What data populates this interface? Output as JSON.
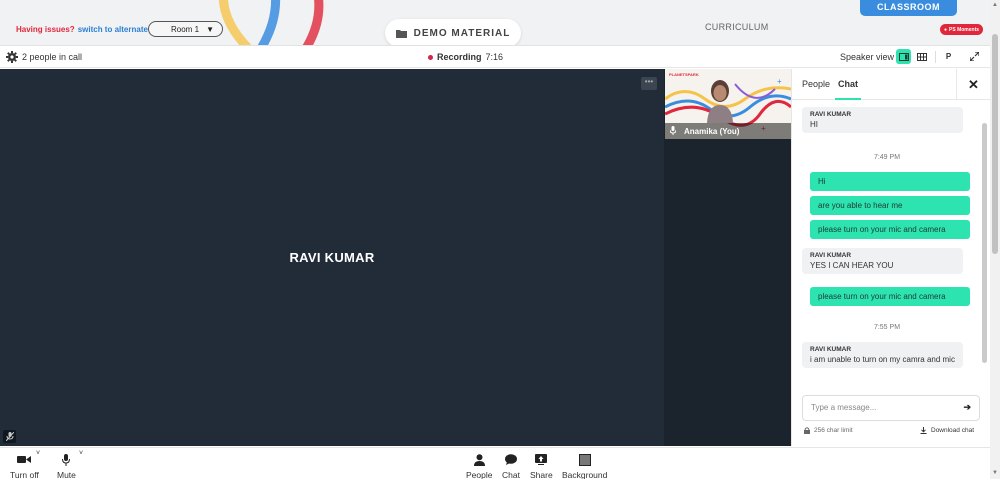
{
  "topbar": {
    "issues_text": "Having issues?",
    "alt_room_link": "switch to alternate room",
    "room_value": "Room 1",
    "demo_material_label": "DEMO MATERIAL",
    "curriculum_label": "CURRICULUM",
    "classroom_label": "CLASSROOM",
    "ps_moments_label": "PS Moments"
  },
  "callbar": {
    "people_count": "2 people in call",
    "recording_label": "Recording",
    "recording_time": "7:16",
    "speaker_view_label": "Speaker view",
    "p_label": "P"
  },
  "main_video": {
    "participant_name": "RAVI KUMAR"
  },
  "self_tile": {
    "name": "Anamika (You)",
    "logo_text": "PLANETSPARK"
  },
  "chat_panel": {
    "tab_people": "People",
    "tab_chat": "Chat",
    "close_icon": "close-icon",
    "messages": [
      {
        "type": "in",
        "sender": "RAVI KUMAR",
        "text": "HI"
      },
      {
        "type": "time",
        "text": "7:49 PM"
      },
      {
        "type": "out",
        "text": "Hi"
      },
      {
        "type": "out",
        "text": "are you able to hear me"
      },
      {
        "type": "out",
        "text": "please turn on your mic and camera"
      },
      {
        "type": "in",
        "sender": "RAVI KUMAR",
        "text": "YES I CAN HEAR YOU"
      },
      {
        "type": "out",
        "text": "please turn on your mic and camera"
      },
      {
        "type": "time",
        "text": "7:55 PM"
      },
      {
        "type": "in",
        "sender": "RAVI KUMAR",
        "text": "i am unable to turn on my camra and mic"
      }
    ],
    "input_placeholder": "Type a message...",
    "char_limit": "256 char limit",
    "download_label": "Download chat"
  },
  "bottombar": {
    "turn_off_label": "Turn off",
    "mute_label": "Mute",
    "people_label": "People",
    "chat_label": "Chat",
    "share_label": "Share",
    "background_label": "Background"
  },
  "colors": {
    "accent": "#2de3b0",
    "video_bg": "#212c38",
    "record_dot": "#d6254a",
    "classroom_tab": "#3a8dde",
    "issues_red": "#e0273b"
  }
}
